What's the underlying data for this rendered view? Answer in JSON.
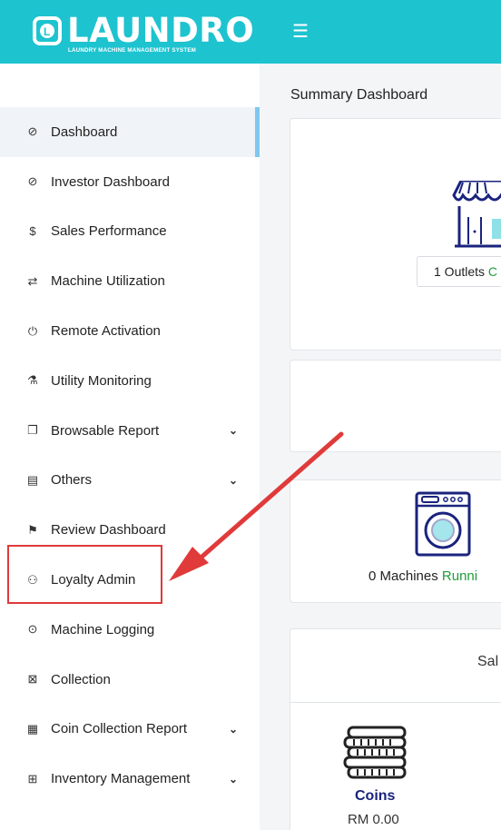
{
  "header": {
    "logo_mark": "L",
    "logo_text": "LAUNDRO",
    "logo_tagline": "LAUNDRY MACHINE MANAGEMENT SYSTEM",
    "menu_icon": "hamburger-icon",
    "brand_color": "#1ec3d0"
  },
  "sidebar": {
    "items": [
      {
        "label": "Dashboard",
        "icon": "gauge-icon",
        "active": true
      },
      {
        "label": "Investor Dashboard",
        "icon": "gauge-icon"
      },
      {
        "label": "Sales Performance",
        "icon": "dollar-icon"
      },
      {
        "label": "Machine Utilization",
        "icon": "swap-icon"
      },
      {
        "label": "Remote Activation",
        "icon": "power-icon"
      },
      {
        "label": "Utility Monitoring",
        "icon": "flask-icon"
      },
      {
        "label": "Browsable Report",
        "icon": "copy-icon",
        "expandable": true
      },
      {
        "label": "Others",
        "icon": "clipboard-icon",
        "expandable": true
      },
      {
        "label": "Review Dashboard",
        "icon": "flag-icon"
      },
      {
        "label": "Loyalty Admin",
        "icon": "users-icon"
      },
      {
        "label": "Machine Logging",
        "icon": "chat-icon"
      },
      {
        "label": "Collection",
        "icon": "box-icon"
      },
      {
        "label": "Coin Collection Report",
        "icon": "receipt-icon",
        "expandable": true
      },
      {
        "label": "Inventory Management",
        "icon": "calendar-box-icon",
        "expandable": true
      }
    ]
  },
  "main": {
    "title": "Summary Dashboard",
    "outlets_count": "1 Outlets",
    "outlets_status_partial": "C",
    "machines_count": "0 Machines",
    "machines_status_partial": "Runni",
    "sales_heading_partial": "Sal",
    "coins_label": "Coins",
    "coins_value": "RM 0.00"
  },
  "annotation": {
    "highlight_color": "#e03a3a"
  }
}
